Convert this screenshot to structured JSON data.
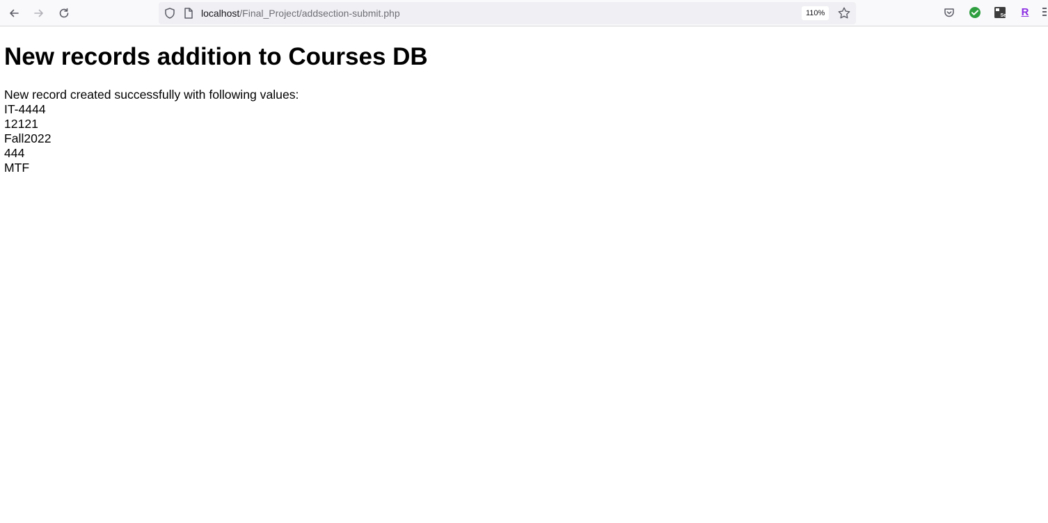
{
  "browser": {
    "url_host": "localhost",
    "url_path": "/Final_Project/addsection-submit.php",
    "zoom": "110%",
    "extension_r_label": "R",
    "icons": [
      "back-arrow-icon",
      "forward-arrow-icon",
      "reload-icon",
      "shield-icon",
      "page-icon",
      "bookmark-star-icon",
      "pocket-icon",
      "check-extension-icon",
      "selenium-extension-icon",
      "r-extension-icon",
      "menu-icon"
    ]
  },
  "page": {
    "heading": "New records addition to Courses DB",
    "message": "New record created successfully with following values:",
    "values": [
      "IT-4444",
      "12121",
      "Fall2022",
      "444",
      "MTF"
    ]
  }
}
